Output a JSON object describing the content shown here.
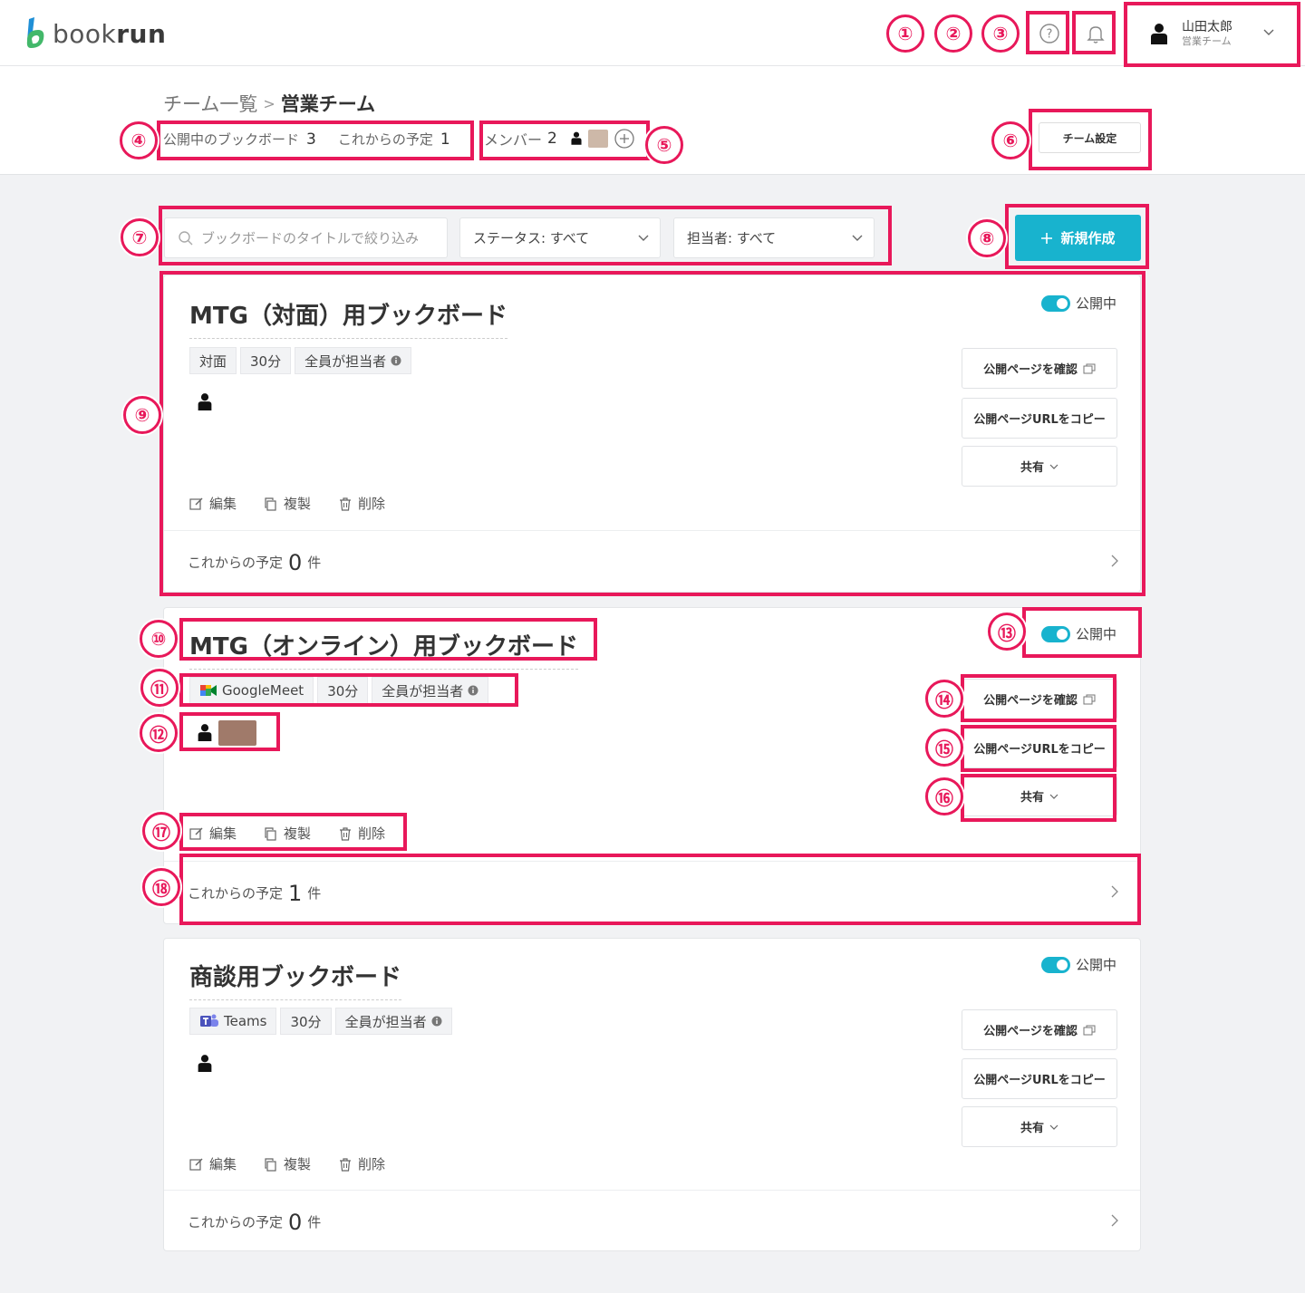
{
  "header": {
    "logo_bold": "run",
    "logo_light": "book",
    "help_icon": "question-circle-icon",
    "bell_icon": "bell-icon",
    "user_name": "山田太郎",
    "user_team": "営業チーム"
  },
  "breadcrumb": {
    "parent": "チーム一覧",
    "separator": ">",
    "current": "営業チーム"
  },
  "stats": {
    "published_label": "公開中のブックボード",
    "published_count": "3",
    "upcoming_label": "これからの予定",
    "upcoming_count": "1",
    "members_label": "メンバー",
    "members_count": "2"
  },
  "team_settings_label": "チーム設定",
  "filters": {
    "search_placeholder": "ブックボードのタイトルで絞り込み",
    "status_label": "ステータス: すべて",
    "assignee_label": "担当者: すべて"
  },
  "new_button_label": "新規作成",
  "card_common": {
    "toggle_label": "公開中",
    "confirm_label": "公開ページを確認",
    "copy_url_label": "公開ページURLをコピー",
    "share_label": "共有",
    "edit_label": "編集",
    "duplicate_label": "複製",
    "delete_label": "削除",
    "upcoming_label": "これからの予定",
    "count_unit": "件"
  },
  "cards": [
    {
      "title": "MTG（対面）用ブックボード",
      "tags": [
        "対面",
        "30分",
        "全員が担当者"
      ],
      "upcoming": "0"
    },
    {
      "title": "MTG（オンライン）用ブックボード",
      "tags": [
        "GoogleMeet",
        "30分",
        "全員が担当者"
      ],
      "upcoming": "1"
    },
    {
      "title": "商談用ブックボード",
      "tags": [
        "Teams",
        "30分",
        "全員が担当者"
      ],
      "upcoming": "0"
    }
  ],
  "callouts": [
    "①",
    "②",
    "③",
    "④",
    "⑤",
    "⑥",
    "⑦",
    "⑧",
    "⑨",
    "⑩",
    "⑪",
    "⑫",
    "⑬",
    "⑭",
    "⑮",
    "⑯",
    "⑰",
    "⑱"
  ],
  "colors": {
    "accent": "#18b3ce",
    "highlight": "#e8185a",
    "background": "#f1f2f4"
  }
}
